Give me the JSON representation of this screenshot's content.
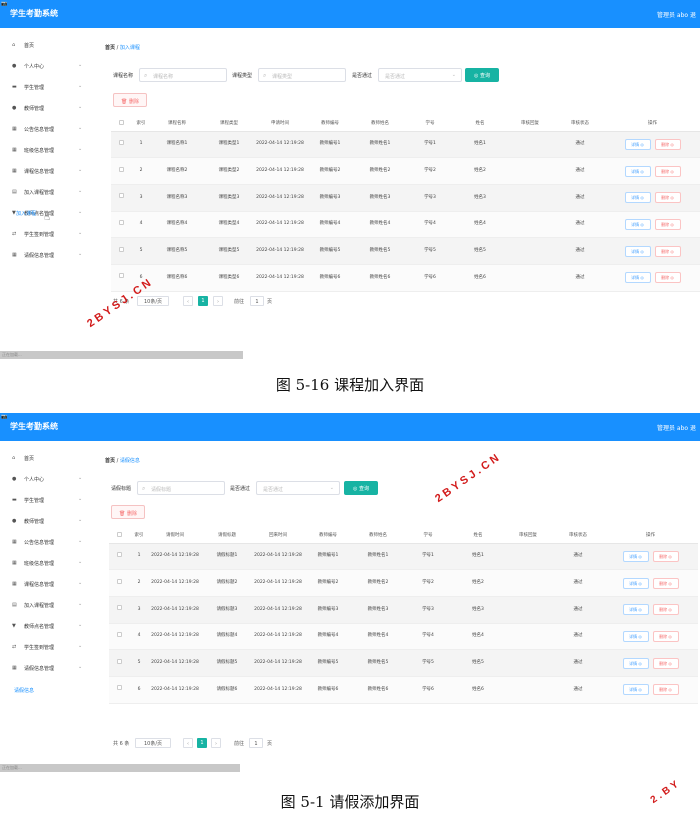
{
  "app": {
    "title": "学生考勤系统",
    "logo": "📷",
    "user": "管理员 abo 退"
  },
  "shot1": {
    "caption": "图 5-16  课程加入界面",
    "sidebar": [
      {
        "label": "首页",
        "icon": "home-icon",
        "glyph": "⌂",
        "chev": ""
      },
      {
        "label": "个人中心",
        "icon": "user-icon",
        "glyph": "●",
        "chev": "⌄"
      },
      {
        "label": "学生管理",
        "icon": "student-icon",
        "glyph": "▬",
        "chev": "⌄"
      },
      {
        "label": "教师管理",
        "icon": "teacher-icon",
        "glyph": "●",
        "chev": "⌄"
      },
      {
        "label": "公告信息管理",
        "icon": "grid-icon",
        "glyph": "▦",
        "chev": "⌄"
      },
      {
        "label": "班级信息管理",
        "icon": "grid-icon",
        "glyph": "▦",
        "chev": "⌄"
      },
      {
        "label": "课程信息管理",
        "icon": "grid-icon",
        "glyph": "▦",
        "chev": "⌄"
      },
      {
        "label": "加入课程管理",
        "icon": "file-icon",
        "glyph": "▤",
        "chev": "⌄"
      },
      {
        "label": "教师点名管理",
        "icon": "thumb-icon",
        "glyph": "▼",
        "chev": "⌄"
      },
      {
        "label": "学生签到管理",
        "icon": "sign-icon",
        "glyph": "⇄",
        "chev": "⌄"
      },
      {
        "label": "请假信息管理",
        "icon": "grid-icon",
        "glyph": "▦",
        "chev": "⌄"
      }
    ],
    "active_sub": "加入课程",
    "breadcrumb": {
      "home": "首页",
      "sep": "/",
      "current": "加入课程"
    },
    "filters": {
      "f1_label": "课程名称",
      "f1_placeholder": "课程名称",
      "f2_label": "课程类型",
      "f2_placeholder": "课程类型",
      "f3_label": "是否通过",
      "f3_placeholder": "是否通过",
      "query": "◎ 查询"
    },
    "delete_label": "🗑 删除",
    "columns": [
      "",
      "索引",
      "课程名称",
      "课程类型",
      "申请时间",
      "教师编号",
      "教师姓名",
      "学号",
      "姓名",
      "审核回复",
      "审核状态",
      "操作"
    ],
    "rows": [
      [
        "1",
        "课程名称1",
        "课程类型1",
        "2022-04-14 12:19:28",
        "教师编号1",
        "教师姓名1",
        "学号1",
        "姓名1",
        "",
        "通过"
      ],
      [
        "2",
        "课程名称2",
        "课程类型2",
        "2022-04-14 12:19:28",
        "教师编号2",
        "教师姓名2",
        "学号2",
        "姓名2",
        "",
        "通过"
      ],
      [
        "3",
        "课程名称3",
        "课程类型3",
        "2022-04-14 12:19:28",
        "教师编号3",
        "教师姓名3",
        "学号3",
        "姓名3",
        "",
        "通过"
      ],
      [
        "4",
        "课程名称4",
        "课程类型4",
        "2022-04-14 12:19:28",
        "教师编号4",
        "教师姓名4",
        "学号4",
        "姓名4",
        "",
        "通过"
      ],
      [
        "5",
        "课程名称5",
        "课程类型5",
        "2022-04-14 12:19:28",
        "教师编号5",
        "教师姓名5",
        "学号5",
        "姓名5",
        "",
        "通过"
      ],
      [
        "6",
        "课程名称6",
        "课程类型6",
        "2022-04-14 12:19:28",
        "教师编号6",
        "教师姓名6",
        "学号6",
        "姓名6",
        "",
        "通过"
      ]
    ],
    "actions": {
      "detail": "详情 ◎",
      "remove": "删除 ◎"
    },
    "pager": {
      "total": "共 6 条",
      "size": "10条/页",
      "page": "1",
      "goto": "前往",
      "goto_value": "1",
      "unit": "页",
      "prev": "‹",
      "next": "›"
    },
    "scroll_text": "正在加载..."
  },
  "shot2": {
    "caption": "图 5-1  请假添加界面",
    "sidebar": [
      {
        "label": "首页",
        "icon": "home-icon",
        "glyph": "⌂",
        "chev": ""
      },
      {
        "label": "个人中心",
        "icon": "user-icon",
        "glyph": "●",
        "chev": "⌄"
      },
      {
        "label": "学生管理",
        "icon": "student-icon",
        "glyph": "▬",
        "chev": "⌄"
      },
      {
        "label": "教师管理",
        "icon": "teacher-icon",
        "glyph": "●",
        "chev": "⌄"
      },
      {
        "label": "公告信息管理",
        "icon": "grid-icon",
        "glyph": "▦",
        "chev": "⌄"
      },
      {
        "label": "班级信息管理",
        "icon": "grid-icon",
        "glyph": "▦",
        "chev": "⌄"
      },
      {
        "label": "课程信息管理",
        "icon": "grid-icon",
        "glyph": "▦",
        "chev": "⌄"
      },
      {
        "label": "加入课程管理",
        "icon": "file-icon",
        "glyph": "▤",
        "chev": "⌄"
      },
      {
        "label": "教师点名管理",
        "icon": "thumb-icon",
        "glyph": "▼",
        "chev": "⌄"
      },
      {
        "label": "学生签到管理",
        "icon": "sign-icon",
        "glyph": "⇄",
        "chev": "⌄"
      },
      {
        "label": "请假信息管理",
        "icon": "grid-icon",
        "glyph": "▦",
        "chev": "⌄"
      }
    ],
    "active_sub": "请假信息",
    "breadcrumb": {
      "home": "首页",
      "sep": "/",
      "current": "请假信息"
    },
    "filters": {
      "f1_label": "请假标题",
      "f1_placeholder": "请假标题",
      "f3_label": "是否通过",
      "f3_placeholder": "是否通过",
      "query": "◎ 查询"
    },
    "delete_label": "🗑 删除",
    "columns": [
      "",
      "索引",
      "请假时间",
      "请假标题",
      "回来时间",
      "教师编号",
      "教师姓名",
      "学号",
      "姓名",
      "审核回复",
      "审核状态",
      "操作"
    ],
    "rows": [
      [
        "1",
        "2022-04-14 12:19:28",
        "请假标题1",
        "2022-04-14 12:19:28",
        "教师编号1",
        "教师姓名1",
        "学号1",
        "姓名1",
        "",
        "通过"
      ],
      [
        "2",
        "2022-04-14 12:19:28",
        "请假标题2",
        "2022-04-14 12:19:28",
        "教师编号2",
        "教师姓名2",
        "学号2",
        "姓名2",
        "",
        "通过"
      ],
      [
        "3",
        "2022-04-14 12:19:28",
        "请假标题3",
        "2022-04-14 12:19:28",
        "教师编号3",
        "教师姓名3",
        "学号3",
        "姓名3",
        "",
        "通过"
      ],
      [
        "4",
        "2022-04-14 12:19:28",
        "请假标题4",
        "2022-04-14 12:19:28",
        "教师编号4",
        "教师姓名4",
        "学号4",
        "姓名4",
        "",
        "通过"
      ],
      [
        "5",
        "2022-04-14 12:19:28",
        "请假标题5",
        "2022-04-14 12:19:28",
        "教师编号5",
        "教师姓名5",
        "学号5",
        "姓名5",
        "",
        "通过"
      ],
      [
        "6",
        "2022-04-14 12:19:28",
        "请假标题6",
        "2022-04-14 12:19:28",
        "教师编号6",
        "教师姓名6",
        "学号6",
        "姓名6",
        "",
        "通过"
      ]
    ],
    "actions": {
      "detail": "详情 ◎",
      "remove": "删除 ◎"
    },
    "pager": {
      "total": "共 6 条",
      "size": "10条/页",
      "page": "1",
      "goto": "前往",
      "goto_value": "1",
      "unit": "页",
      "prev": "‹",
      "next": "›"
    },
    "scroll_text": "正在加载..."
  },
  "watermark": "2BYSJ.CN",
  "watermark_partial": "2.BY",
  "colors": {
    "topbar": "#1890ff",
    "accent": "#17b3a3",
    "danger": "#f56c6c",
    "watermark": "#d21a1a"
  }
}
